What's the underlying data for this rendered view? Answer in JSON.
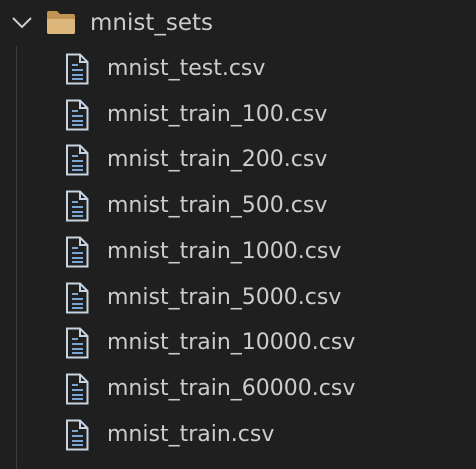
{
  "explorer": {
    "folder": {
      "name": "mnist_sets",
      "expanded": true,
      "icon": "folder-open-icon",
      "icon_color": "#dcb67a"
    },
    "file_icon": "csv-file-icon",
    "file_icon_color": "#c5d4e0",
    "files": [
      {
        "name": "mnist_test.csv"
      },
      {
        "name": "mnist_train_100.csv"
      },
      {
        "name": "mnist_train_200.csv"
      },
      {
        "name": "mnist_train_500.csv"
      },
      {
        "name": "mnist_train_1000.csv"
      },
      {
        "name": "mnist_train_5000.csv"
      },
      {
        "name": "mnist_train_10000.csv"
      },
      {
        "name": "mnist_train_60000.csv"
      },
      {
        "name": "mnist_train.csv"
      }
    ]
  }
}
